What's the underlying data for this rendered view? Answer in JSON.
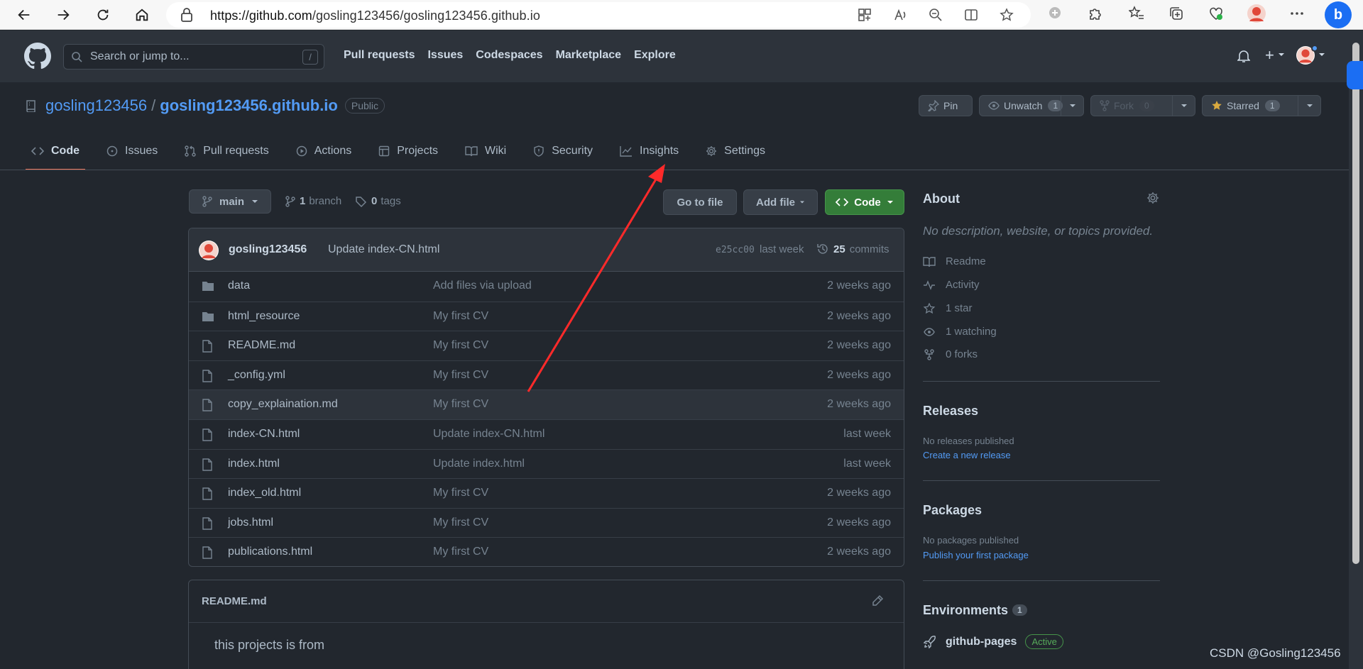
{
  "browser": {
    "url_host": "https://github.com",
    "url_path": "/gosling123456/gosling123456.github.io"
  },
  "header": {
    "search_placeholder": "Search or jump to...",
    "search_shortcut": "/",
    "nav": [
      "Pull requests",
      "Issues",
      "Codespaces",
      "Marketplace",
      "Explore"
    ],
    "plus_icon": "+"
  },
  "repo": {
    "owner": "gosling123456",
    "separator": "/",
    "name": "gosling123456.github.io",
    "visibility": "Public",
    "actions": {
      "pin": "Pin",
      "unwatch": "Unwatch",
      "unwatch_count": "1",
      "fork": "Fork",
      "fork_count": "0",
      "starred": "Starred",
      "star_count": "1"
    },
    "tabs": [
      {
        "label": "Code",
        "icon": "code-icon"
      },
      {
        "label": "Issues",
        "icon": "issue-icon"
      },
      {
        "label": "Pull requests",
        "icon": "pull-request-icon"
      },
      {
        "label": "Actions",
        "icon": "play-icon"
      },
      {
        "label": "Projects",
        "icon": "table-icon"
      },
      {
        "label": "Wiki",
        "icon": "book-icon"
      },
      {
        "label": "Security",
        "icon": "shield-icon"
      },
      {
        "label": "Insights",
        "icon": "graph-icon"
      },
      {
        "label": "Settings",
        "icon": "gear-icon"
      }
    ]
  },
  "browser_panel": {
    "branch": "main",
    "branch_count": "1",
    "branch_label": "branch",
    "tag_count": "0",
    "tag_label": "tags",
    "go_to_file": "Go to file",
    "add_file": "Add file",
    "code": "Code"
  },
  "commit": {
    "author": "gosling123456",
    "message": "Update index-CN.html",
    "sha": "e25cc00",
    "time": "last week",
    "count": "25",
    "count_label": "commits"
  },
  "files": [
    {
      "name": "data",
      "type": "folder",
      "message": "Add files via upload",
      "time": "2 weeks ago"
    },
    {
      "name": "html_resource",
      "type": "folder",
      "message": "My first CV",
      "time": "2 weeks ago"
    },
    {
      "name": "README.md",
      "type": "file",
      "message": "My first CV",
      "time": "2 weeks ago"
    },
    {
      "name": "_config.yml",
      "type": "file",
      "message": "My first CV",
      "time": "2 weeks ago"
    },
    {
      "name": "copy_explaination.md",
      "type": "file",
      "message": "My first CV",
      "time": "2 weeks ago"
    },
    {
      "name": "index-CN.html",
      "type": "file",
      "message": "Update index-CN.html",
      "time": "last week"
    },
    {
      "name": "index.html",
      "type": "file",
      "message": "Update index.html",
      "time": "last week"
    },
    {
      "name": "index_old.html",
      "type": "file",
      "message": "My first CV",
      "time": "2 weeks ago"
    },
    {
      "name": "jobs.html",
      "type": "file",
      "message": "My first CV",
      "time": "2 weeks ago"
    },
    {
      "name": "publications.html",
      "type": "file",
      "message": "My first CV",
      "time": "2 weeks ago"
    }
  ],
  "readme": {
    "title": "README.md",
    "body": "this projects is from"
  },
  "sidebar": {
    "about_title": "About",
    "about_desc": "No description, website, or topics provided.",
    "about_items": [
      "Readme",
      "Activity",
      "1 star",
      "1 watching",
      "0 forks"
    ],
    "releases_title": "Releases",
    "releases_none": "No releases published",
    "releases_link": "Create a new release",
    "packages_title": "Packages",
    "packages_none": "No packages published",
    "packages_link": "Publish your first package",
    "env_title": "Environments",
    "env_count": "1",
    "env_name": "github-pages",
    "env_status": "Active"
  },
  "watermark": "CSDN @Gosling123456",
  "colors": {
    "bg": "#22272e",
    "header": "#2d333b",
    "link": "#539bf5",
    "green": "#347d39",
    "accent_underline": "#ec775c",
    "arrow": "#ff2a2a"
  }
}
